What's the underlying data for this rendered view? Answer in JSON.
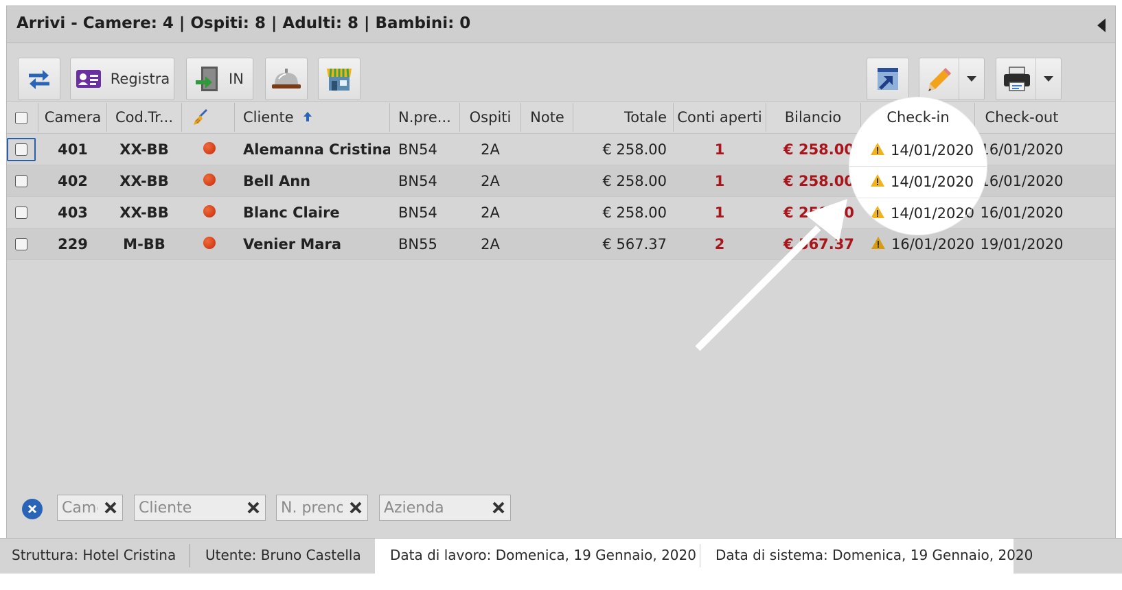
{
  "panel": {
    "title": "Arrivi - Camere: 4 | Ospiti: 8 | Adulti: 8 | Bambini: 0"
  },
  "toolbar": {
    "registra_label": "Registra",
    "checkin_label": "IN"
  },
  "columns": {
    "camera": "Camera",
    "cod_tr": "Cod.Tr...",
    "cliente": "Cliente",
    "n_pre": "N.pre...",
    "ospiti": "Ospiti",
    "note": "Note",
    "totale": "Totale",
    "conti_aperti": "Conti aperti",
    "bilancio": "Bilancio",
    "checkin": "Check-in",
    "checkout": "Check-out"
  },
  "rows": [
    {
      "camera": "401",
      "cod_tr": "XX-BB",
      "cliente": "Alemanna Cristina",
      "n_pre": "BN54",
      "ospiti": "2A",
      "note": "",
      "totale": "€ 258.00",
      "conti_aperti": "1",
      "bilancio": "€ 258.00",
      "checkin": "14/01/2020",
      "checkout": "16/01/2020"
    },
    {
      "camera": "402",
      "cod_tr": "XX-BB",
      "cliente": "Bell Ann",
      "n_pre": "BN54",
      "ospiti": "2A",
      "note": "",
      "totale": "€ 258.00",
      "conti_aperti": "1",
      "bilancio": "€ 258.00",
      "checkin": "14/01/2020",
      "checkout": "16/01/2020"
    },
    {
      "camera": "403",
      "cod_tr": "XX-BB",
      "cliente": "Blanc Claire",
      "n_pre": "BN54",
      "ospiti": "2A",
      "note": "",
      "totale": "€ 258.00",
      "conti_aperti": "1",
      "bilancio": "€ 258.00",
      "checkin": "14/01/2020",
      "checkout": "16/01/2020"
    },
    {
      "camera": "229",
      "cod_tr": "M-BB",
      "cliente": "Venier Mara",
      "n_pre": "BN55",
      "ospiti": "2A",
      "note": "",
      "totale": "€ 567.37",
      "conti_aperti": "2",
      "bilancio": "€ 567.37",
      "checkin": "16/01/2020",
      "checkout": "19/01/2020"
    }
  ],
  "filters": {
    "camera_placeholder": "Camera",
    "cliente_placeholder": "Cliente",
    "npreno_placeholder": "N. preno",
    "azienda_placeholder": "Azienda"
  },
  "status": {
    "struttura": "Struttura: Hotel Cristina",
    "utente": "Utente: Bruno Castella",
    "data_lavoro": "Data di lavoro: Domenica, 19 Gennaio, 2020",
    "data_sistema": "Data di sistema: Domenica, 19 Gennaio, 2020"
  },
  "colors": {
    "accent_blue": "#2a64b7",
    "balance_red": "#a8151a",
    "warning_yellow": "#f2b21b",
    "status_dot": "#d8391a",
    "overlay_gray": "#d6d6d6"
  },
  "icons": [
    "refresh-icon",
    "guest-card-icon",
    "door-in-icon",
    "reception-bell-icon",
    "shop-icon",
    "broom-icon",
    "sort-asc-icon",
    "export-icon",
    "pencil-icon",
    "printer-icon",
    "warning-icon",
    "clear-icon",
    "collapse-icon"
  ]
}
